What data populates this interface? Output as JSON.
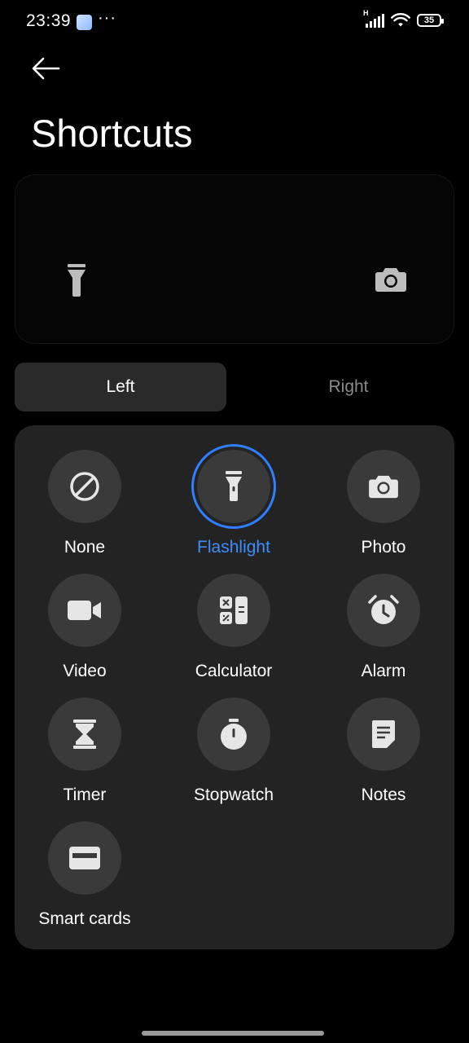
{
  "status_bar": {
    "time": "23:39",
    "more": "···",
    "network_type": "H",
    "battery_level": "35"
  },
  "header": {
    "back_icon": "arrow-left-icon",
    "title": "Shortcuts"
  },
  "preview": {
    "left_icon": "flashlight-icon",
    "right_icon": "camera-icon"
  },
  "segment": {
    "left_label": "Left",
    "right_label": "Right",
    "selected": "Left"
  },
  "options": [
    {
      "label": "None",
      "icon": "none-icon",
      "selected": false
    },
    {
      "label": "Flashlight",
      "icon": "flashlight-icon",
      "selected": true
    },
    {
      "label": "Photo",
      "icon": "camera-icon",
      "selected": false
    },
    {
      "label": "Video",
      "icon": "video-icon",
      "selected": false
    },
    {
      "label": "Calculator",
      "icon": "calculator-icon",
      "selected": false
    },
    {
      "label": "Alarm",
      "icon": "alarm-icon",
      "selected": false
    },
    {
      "label": "Timer",
      "icon": "hourglass-icon",
      "selected": false
    },
    {
      "label": "Stopwatch",
      "icon": "stopwatch-icon",
      "selected": false
    },
    {
      "label": "Notes",
      "icon": "notes-icon",
      "selected": false
    },
    {
      "label": "Smart cards",
      "icon": "card-icon",
      "selected": false
    }
  ],
  "colors": {
    "accent": "#3d8bff",
    "background": "#000000",
    "panel": "#232323",
    "circle": "#3a3a3a"
  }
}
